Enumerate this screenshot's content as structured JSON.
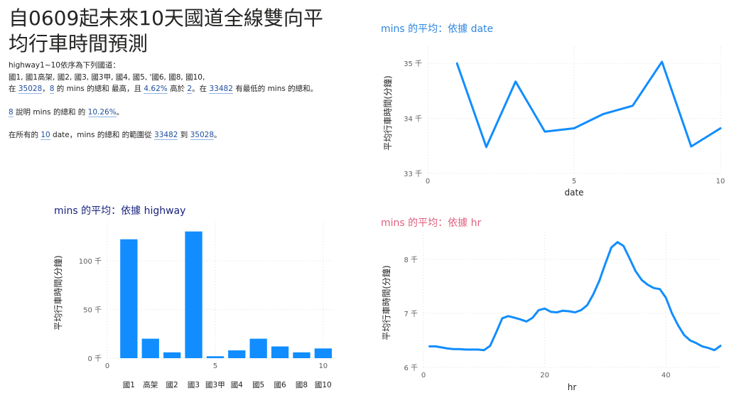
{
  "page": {
    "title": "自0609起未來10天國道全線雙向平均行車時間預測"
  },
  "narrative": {
    "line1": "highway1~10依序為下列國道：",
    "line2": "國1, 國1高架, 國2, 國3, 國3甲, 國4, 國5, '國6, 國8, 國10,",
    "line3_a": "在 ",
    "line3_v1": "35028",
    "line3_b": "，",
    "line3_v2": "8",
    "line3_c": " 的 mins 的總和 最高，且 ",
    "line3_v3": "4.62%",
    "line3_d": " 高於 ",
    "line3_v4": "2",
    "line3_e": "。在 ",
    "line3_v5": "33482",
    "line3_f": " 有最低的 mins 的總和。",
    "line4_v1": "8",
    "line4_a": " 說明 mins 的總和 的 ",
    "line4_v2": "10.26%",
    "line4_b": "。",
    "line5_a": "在所有的 ",
    "line5_v1": "10",
    "line5_b": " date，mins 的總和 的範圍從 ",
    "line5_v2": "33482",
    "line5_c": " 到 ",
    "line5_v3": "35028",
    "line5_d": "。"
  },
  "colors": {
    "series": "#118dff",
    "title_date": "#2e86de",
    "title_highway": "#1a237e",
    "title_hr": "#e0607e",
    "axis_text": "#605e5c",
    "grid": "#e1dfdd"
  },
  "chart_data": [
    {
      "id": "date",
      "type": "line",
      "title": "mins 的平均：依據 date",
      "xlabel": "date",
      "ylabel": "平均行車時間(分鐘)",
      "xlim": [
        0,
        10
      ],
      "ylim": [
        33,
        35.3
      ],
      "xticks": [
        0,
        5,
        10
      ],
      "xtick_labels": [
        "0",
        "5",
        "10"
      ],
      "yticks": [
        33,
        34,
        35
      ],
      "ytick_labels": [
        "33 千",
        "34 千",
        "35 千"
      ],
      "grid": true,
      "x": [
        1,
        2,
        3,
        4,
        5,
        6,
        7,
        8,
        9,
        10
      ],
      "values": [
        35.0,
        33.48,
        34.67,
        33.76,
        33.82,
        34.08,
        34.23,
        35.03,
        33.49,
        33.82
      ]
    },
    {
      "id": "highway",
      "type": "bar",
      "title": "mins 的平均：依據 highway",
      "xlabel": "",
      "ylabel": "平均行車時間(分鐘)",
      "xlim": [
        0,
        10.5
      ],
      "ylim": [
        0,
        140
      ],
      "xticks": [
        0,
        5,
        10
      ],
      "xtick_labels": [
        "0",
        "5",
        "10"
      ],
      "yticks": [
        0,
        50,
        100
      ],
      "ytick_labels": [
        "0 千",
        "50 千",
        "100 千"
      ],
      "grid": true,
      "x": [
        1,
        2,
        3,
        4,
        5,
        6,
        7,
        8,
        9,
        10
      ],
      "categories": [
        "國1",
        "高架",
        "國2",
        "國3",
        "國3甲",
        "國4",
        "國5",
        "國6",
        "國8",
        "國10"
      ],
      "values": [
        122,
        20,
        6,
        130,
        2,
        8,
        20,
        12,
        6,
        10
      ]
    },
    {
      "id": "hr",
      "type": "line",
      "title": "mins 的平均：依據 hr",
      "xlabel": "hr",
      "ylabel": "平均行車時間(分鐘)",
      "xlim": [
        0,
        49
      ],
      "ylim": [
        6,
        8.5
      ],
      "xticks": [
        0,
        20,
        40
      ],
      "xtick_labels": [
        "0",
        "20",
        "40"
      ],
      "yticks": [
        6,
        7,
        8
      ],
      "ytick_labels": [
        "6 千",
        "7 千",
        "8 千"
      ],
      "grid": true,
      "x": [
        1,
        2,
        3,
        4,
        5,
        6,
        7,
        8,
        9,
        10,
        11,
        12,
        13,
        14,
        15,
        16,
        17,
        18,
        19,
        20,
        21,
        22,
        23,
        24,
        25,
        26,
        27,
        28,
        29,
        30,
        31,
        32,
        33,
        34,
        35,
        36,
        37,
        38,
        39,
        40,
        41,
        42,
        43,
        44,
        45,
        46,
        47,
        48,
        49
      ],
      "values": [
        6.39,
        6.39,
        6.37,
        6.35,
        6.34,
        6.34,
        6.33,
        6.33,
        6.33,
        6.32,
        6.4,
        6.65,
        6.91,
        6.95,
        6.92,
        6.89,
        6.85,
        6.92,
        7.06,
        7.09,
        7.03,
        7.02,
        7.05,
        7.04,
        7.02,
        7.06,
        7.15,
        7.35,
        7.6,
        7.92,
        8.22,
        8.32,
        8.25,
        8.02,
        7.78,
        7.62,
        7.53,
        7.47,
        7.45,
        7.29,
        7.0,
        6.78,
        6.6,
        6.5,
        6.45,
        6.39,
        6.36,
        6.32,
        6.4
      ]
    }
  ]
}
